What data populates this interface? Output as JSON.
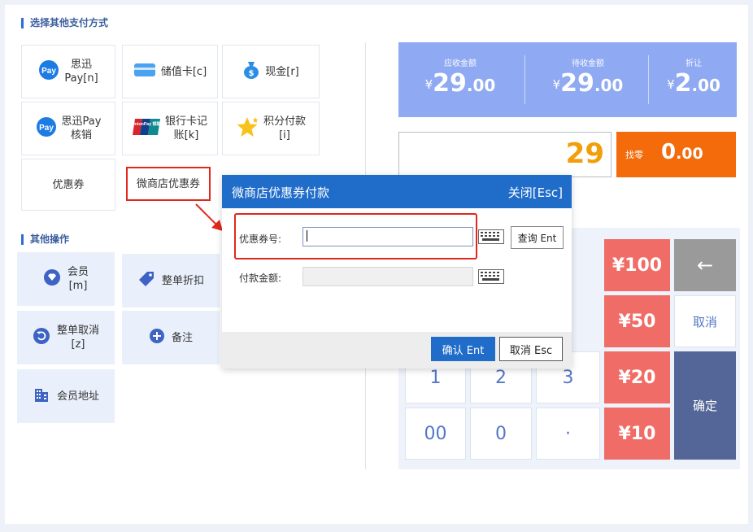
{
  "sections": {
    "other_payment": "选择其他支付方式",
    "other_ops": "其他操作"
  },
  "payment_methods": [
    {
      "line1": "思迅",
      "line2": "Pay[n]",
      "icon": "pay-icon"
    },
    {
      "line1": "储值卡[c]",
      "icon": "card-icon"
    },
    {
      "line1": "现金[r]",
      "icon": "cash-bag-icon"
    },
    {
      "line1": "思迅Pay",
      "line2": "核销",
      "icon": "pay-icon"
    },
    {
      "line1": "银行卡记",
      "line2": "账[k]",
      "icon": "unionpay-icon",
      "icon_text": "UnionPay 银联"
    },
    {
      "line1": "积分付款",
      "line2": "[i]",
      "icon": "star-icon"
    },
    {
      "line1": "优惠券"
    },
    {
      "line1": "微商店优惠券",
      "highlighted": true
    }
  ],
  "other_operations": [
    {
      "line1": "会员",
      "line2": "[m]",
      "icon": "diamond-icon"
    },
    {
      "line1": "整单折扣",
      "icon": "tag-icon"
    },
    {
      "line1": "整单取消",
      "line2": "[z]",
      "icon": "undo-icon"
    },
    {
      "line1": "备注",
      "icon": "plus-circle-icon"
    },
    {
      "line1": "会员地址",
      "icon": "building-icon"
    }
  ],
  "summary": {
    "receivable_label": "应收金额",
    "receivable_int": "29",
    "receivable_dec": ".00",
    "pending_label": "待收金额",
    "pending_int": "29",
    "pending_dec": ".00",
    "discount_label": "折让",
    "discount_int": "2",
    "discount_dec": ".00",
    "currency": "¥"
  },
  "tender": {
    "amount": "29",
    "change_label": "找零",
    "change_int": "0",
    "change_dec": ".00"
  },
  "keypad": {
    "k1": "1",
    "k2": "2",
    "k3": "3",
    "k00": "00",
    "k0": "0",
    "kdot": "·",
    "m100": "¥100",
    "m50": "¥50",
    "m20": "¥20",
    "m10": "¥10",
    "backspace": "←",
    "cancel": "取消",
    "confirm": "确定"
  },
  "dialog": {
    "title": "微商店优惠券付款",
    "close": "关闭[Esc]",
    "coupon_label": "优惠券号:",
    "coupon_value": "",
    "query_btn": "查询 Ent",
    "pay_label": "付款金额:",
    "pay_value": "",
    "confirm_btn": "确认 Ent",
    "cancel_btn": "取消 Esc"
  },
  "colors": {
    "primary": "#1f6cc9",
    "summary_bg": "#8faaf2",
    "amount_orange": "#f29e0b",
    "change_bg": "#f46b0b",
    "money_key": "#f06c66",
    "confirm_key": "#536697",
    "highlight_red": "#e0281c"
  }
}
